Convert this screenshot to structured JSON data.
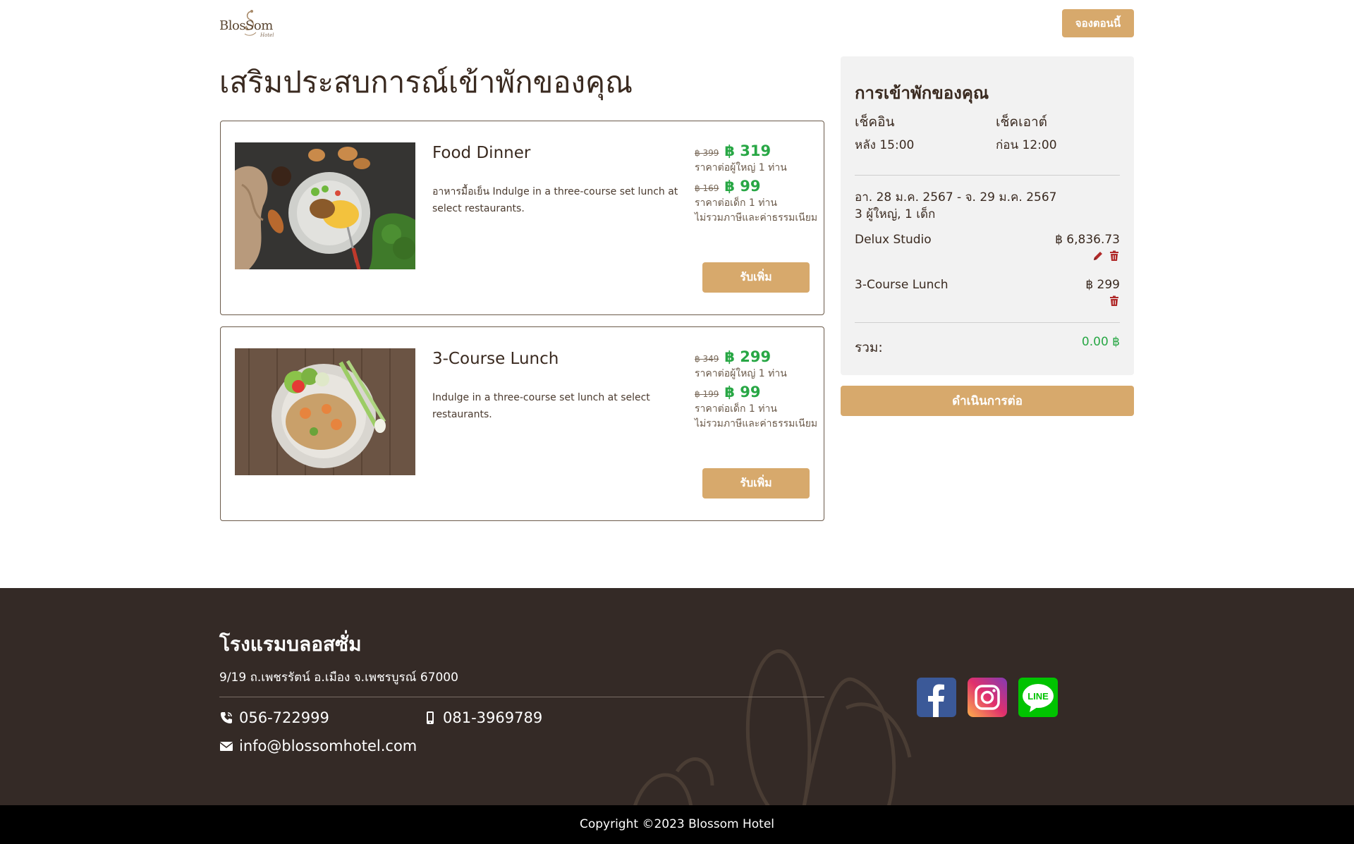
{
  "header": {
    "logo_text": "BlosSom",
    "logo_sub": "Hotel",
    "book_now_label": "จองตอนนี้"
  },
  "page_title": "เสริมประสบการณ์เข้าพักของคุณ",
  "products": [
    {
      "name": "Food Dinner",
      "description": "อาหารมื้อเย็น Indulge in a three-course set lunch at select restaurants.",
      "adult_old_price": "฿ 399",
      "adult_new_price": "฿ 319",
      "adult_note": "ราคาต่อผู้ใหญ่ 1 ท่าน",
      "child_old_price": "฿ 169",
      "child_new_price": "฿ 99",
      "child_note": "ราคาต่อเด็ก 1 ท่าน",
      "tax_note": "ไม่รวมภาษีและค่าธรรมเนียม",
      "button_label": "รับเพิ่ม"
    },
    {
      "name": "3-Course Lunch",
      "description": "Indulge in a three-course set lunch at select restaurants.",
      "adult_old_price": "฿ 349",
      "adult_new_price": "฿ 299",
      "adult_note": "ราคาต่อผู้ใหญ่ 1 ท่าน",
      "child_old_price": "฿ 199",
      "child_new_price": "฿ 99",
      "child_note": "ราคาต่อเด็ก 1 ท่าน",
      "tax_note": "ไม่รวมภาษีและค่าธรรมเนียม",
      "button_label": "รับเพิ่ม"
    }
  ],
  "summary": {
    "title": "การเข้าพักของคุณ",
    "checkin_label": "เช็คอิน",
    "checkin_value": "หลัง 15:00",
    "checkout_label": "เช็คเอาต์",
    "checkout_value": "ก่อน 12:00",
    "dates": "อา. 28 ม.ค. 2567 - จ. 29 ม.ค. 2567",
    "guests": "3 ผู้ใหญ่, 1 เด็ก",
    "items": [
      {
        "name": "Delux Studio",
        "price": "฿ 6,836.73"
      },
      {
        "name": "3-Course Lunch",
        "price": "฿ 299"
      }
    ],
    "total_label": "รวม:",
    "total_value": "0.00 ฿",
    "proceed_label": "ดำเนินการต่อ"
  },
  "footer": {
    "hotel_name": "โรงแรมบลอสซั่ม",
    "address": "9/19 ถ.เพชรรัตน์ อ.เมือง จ.เพชรบูรณ์ 67000",
    "phone": "056-722999",
    "mobile": "081-3969789",
    "email": "info@blossomhotel.com",
    "social_icons": [
      "facebook-icon",
      "instagram-icon",
      "line-icon"
    ],
    "line_text": "LINE",
    "copyright": "Copyright ©2023 Blossom Hotel"
  },
  "colors": {
    "accent": "#d7a96c",
    "price_green": "#28a745",
    "footer_bg": "#342a26",
    "text_dark": "#3a2a20",
    "delete_red": "#b02a2a"
  }
}
